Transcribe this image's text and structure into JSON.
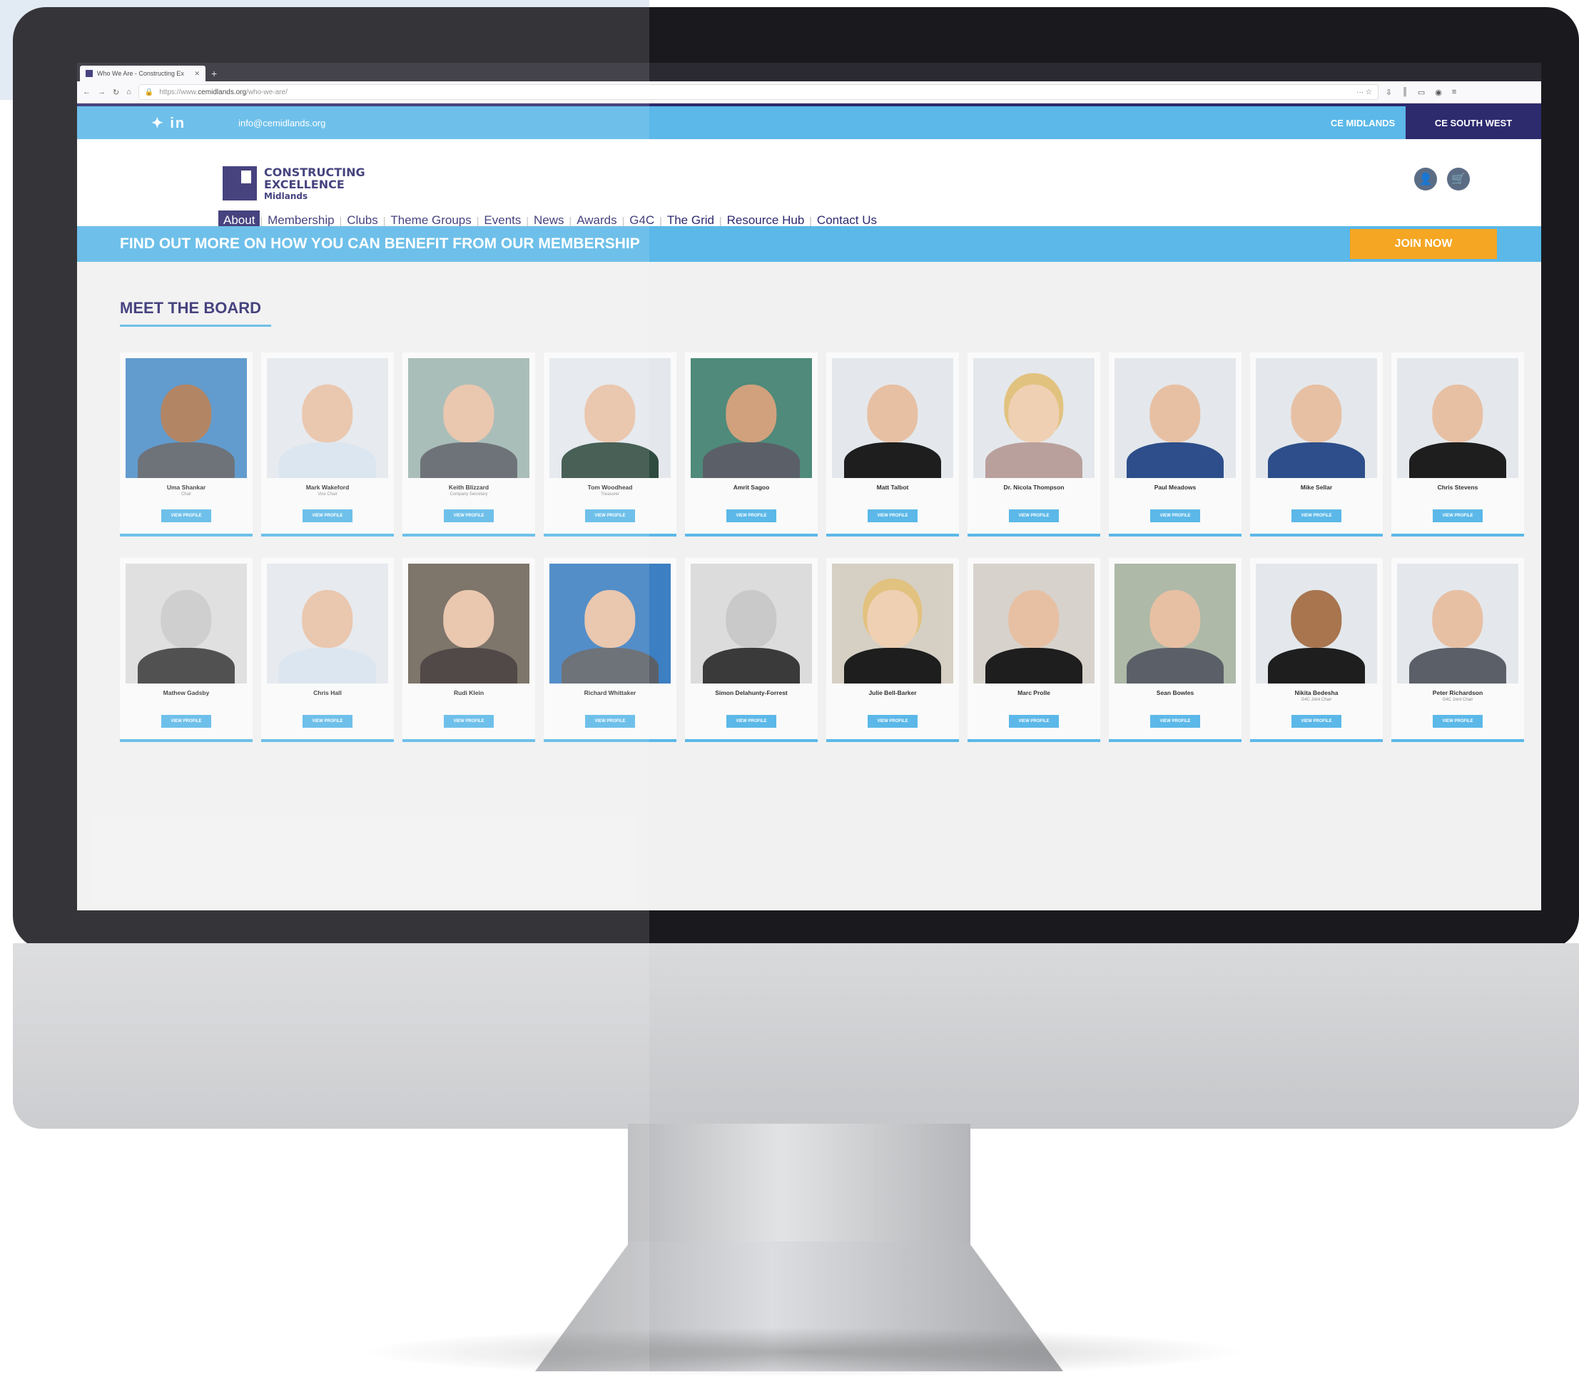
{
  "browser": {
    "tab_title": "Who We Are - Constructing Ex",
    "url_prefix": "https://www.",
    "url_domain": "cemidlands.org",
    "url_path": "/who-we-are/"
  },
  "topbar": {
    "social": "✦ in",
    "email": "info@cemidlands.org",
    "region_midlands": "CE MIDLANDS",
    "region_south_west": "CE SOUTH WEST"
  },
  "logo": {
    "line1": "CONSTRUCTING",
    "line2": "EXCELLENCE",
    "line3": "Midlands"
  },
  "nav": [
    "About",
    "Membership",
    "Clubs",
    "Theme Groups",
    "Events",
    "News",
    "Awards",
    "G4C",
    "The Grid",
    "Resource Hub",
    "Contact Us"
  ],
  "banner": {
    "message": "FIND OUT MORE ON HOW YOU CAN BENEFIT FROM OUR MEMBERSHIP",
    "join_label": "JOIN NOW"
  },
  "board": {
    "title": "MEET THE BOARD",
    "button_label": "VIEW PROFILE",
    "members": [
      {
        "name": "Uma Shankar",
        "role": "Chair"
      },
      {
        "name": "Mark Wakeford",
        "role": "Vice Chair"
      },
      {
        "name": "Keith Blizzard",
        "role": "Company Secretary"
      },
      {
        "name": "Tom Woodhead",
        "role": "Treasurer"
      },
      {
        "name": "Amrit Sagoo",
        "role": ""
      },
      {
        "name": "Matt Talbot",
        "role": ""
      },
      {
        "name": "Dr. Nicola Thompson",
        "role": ""
      },
      {
        "name": "Paul Meadows",
        "role": ""
      },
      {
        "name": "Mike Sellar",
        "role": ""
      },
      {
        "name": "Chris Stevens",
        "role": ""
      },
      {
        "name": "Mathew Gadsby",
        "role": ""
      },
      {
        "name": "Chris Hall",
        "role": ""
      },
      {
        "name": "Rudi Klein",
        "role": ""
      },
      {
        "name": "Richard Whittaker",
        "role": ""
      },
      {
        "name": "Simon Delahunty-Forrest",
        "role": ""
      },
      {
        "name": "Julie Bell-Barker",
        "role": ""
      },
      {
        "name": "Marc Prolle",
        "role": ""
      },
      {
        "name": "Sean Bowles",
        "role": ""
      },
      {
        "name": "Nikita Bedesha",
        "role": "G4C Joint Chair"
      },
      {
        "name": "Peter Richardson",
        "role": "G4C Joint Chair"
      }
    ]
  }
}
